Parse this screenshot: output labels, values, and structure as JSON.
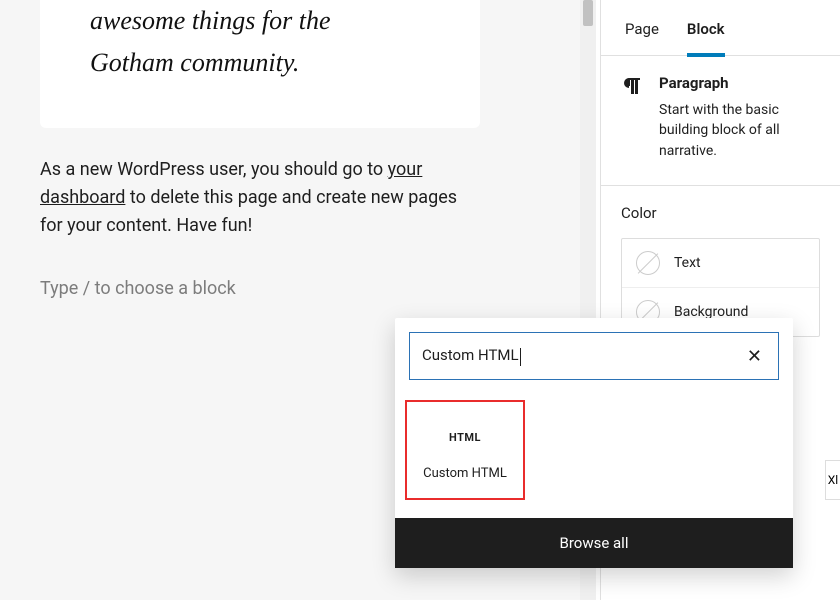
{
  "editor": {
    "hero_line1": "awesome things for the",
    "hero_line2": "Gotham community.",
    "para_before_link": "As a new WordPress user, you should go to ",
    "para_link": "your dashboard",
    "para_after_link": " to delete this page and create new pages for your content. Have fun!",
    "placeholder": "Type / to choose a block"
  },
  "sidebar": {
    "tabs": {
      "page": "Page",
      "block": "Block"
    },
    "block_info": {
      "title": "Paragraph",
      "subtitle": "Start with the basic building block of all narrative."
    },
    "color": {
      "heading": "Color",
      "rows": {
        "text": "Text",
        "background": "Background"
      }
    },
    "extra": "Xl"
  },
  "inserter": {
    "search_value": "Custom HTML",
    "clear_symbol": "✕",
    "result": {
      "icon_text": "HTML",
      "label": "Custom HTML"
    },
    "browse_all": "Browse all"
  }
}
